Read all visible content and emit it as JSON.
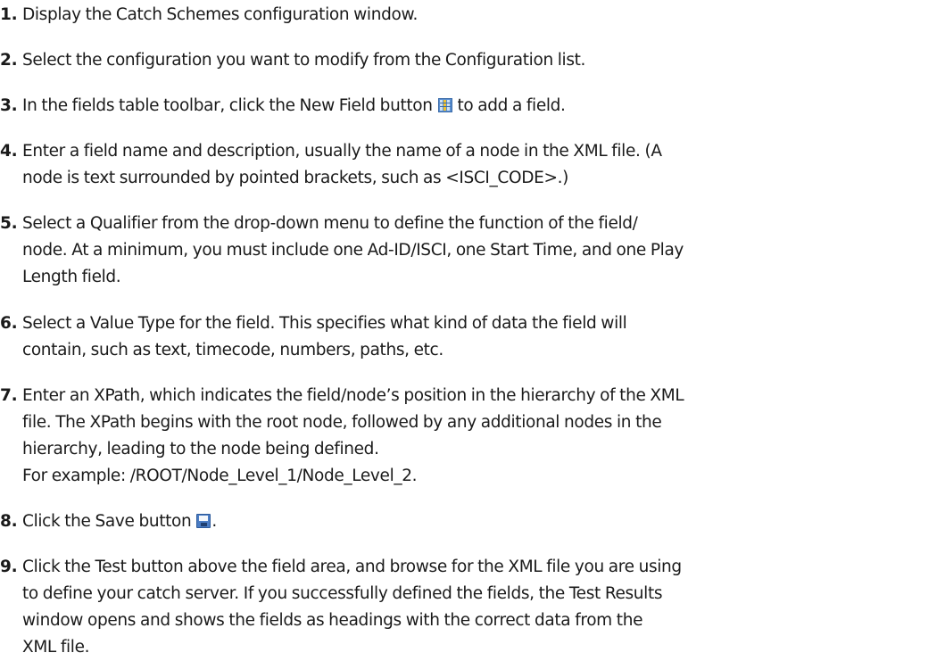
{
  "steps": [
    {
      "number": "1.",
      "lines": [
        "Display the Catch Schemes configuration window."
      ]
    },
    {
      "number": "2.",
      "lines": [
        "Select the configuration you want to modify from the Configuration list."
      ]
    },
    {
      "number": "3.",
      "before_icon": "In the fields table toolbar, click the New Field button",
      "icon": "new-field-icon",
      "after_icon": "to add a field."
    },
    {
      "number": "4.",
      "lines": [
        "Enter a field name and description, usually the name of a node in the XML file. (A",
        "node is text surrounded by pointed brackets, such as <ISCI_CODE>.)"
      ]
    },
    {
      "number": "5.",
      "lines": [
        "Select a Qualifier from the drop-down menu to define the function of the field/",
        "node. At a minimum, you must include one Ad-ID/ISCI, one Start Time, and one Play",
        "Length field."
      ]
    },
    {
      "number": "6.",
      "lines": [
        "Select a Value Type for the field. This specifies what kind of data the field will",
        "contain, such as text, timecode, numbers, paths, etc."
      ]
    },
    {
      "number": "7.",
      "lines": [
        "Enter an XPath, which indicates the field/node’s position in the hierarchy of the XML",
        "file. The XPath begins with the root node, followed by any additional nodes in the",
        "hierarchy, leading to the node being defined.",
        "For example: /ROOT/Node_Level_1/Node_Level_2."
      ]
    },
    {
      "number": "8.",
      "before_icon": "Click the Save button",
      "icon": "save-icon",
      "after_icon": "."
    },
    {
      "number": "9.",
      "lines": [
        "Click the Test button above the field area, and browse for the XML file you are using",
        "to define your catch server. If you successfully defined the fields, the Test Results",
        "window opens and shows the fields as headings with the correct data from the",
        "XML file."
      ]
    }
  ]
}
